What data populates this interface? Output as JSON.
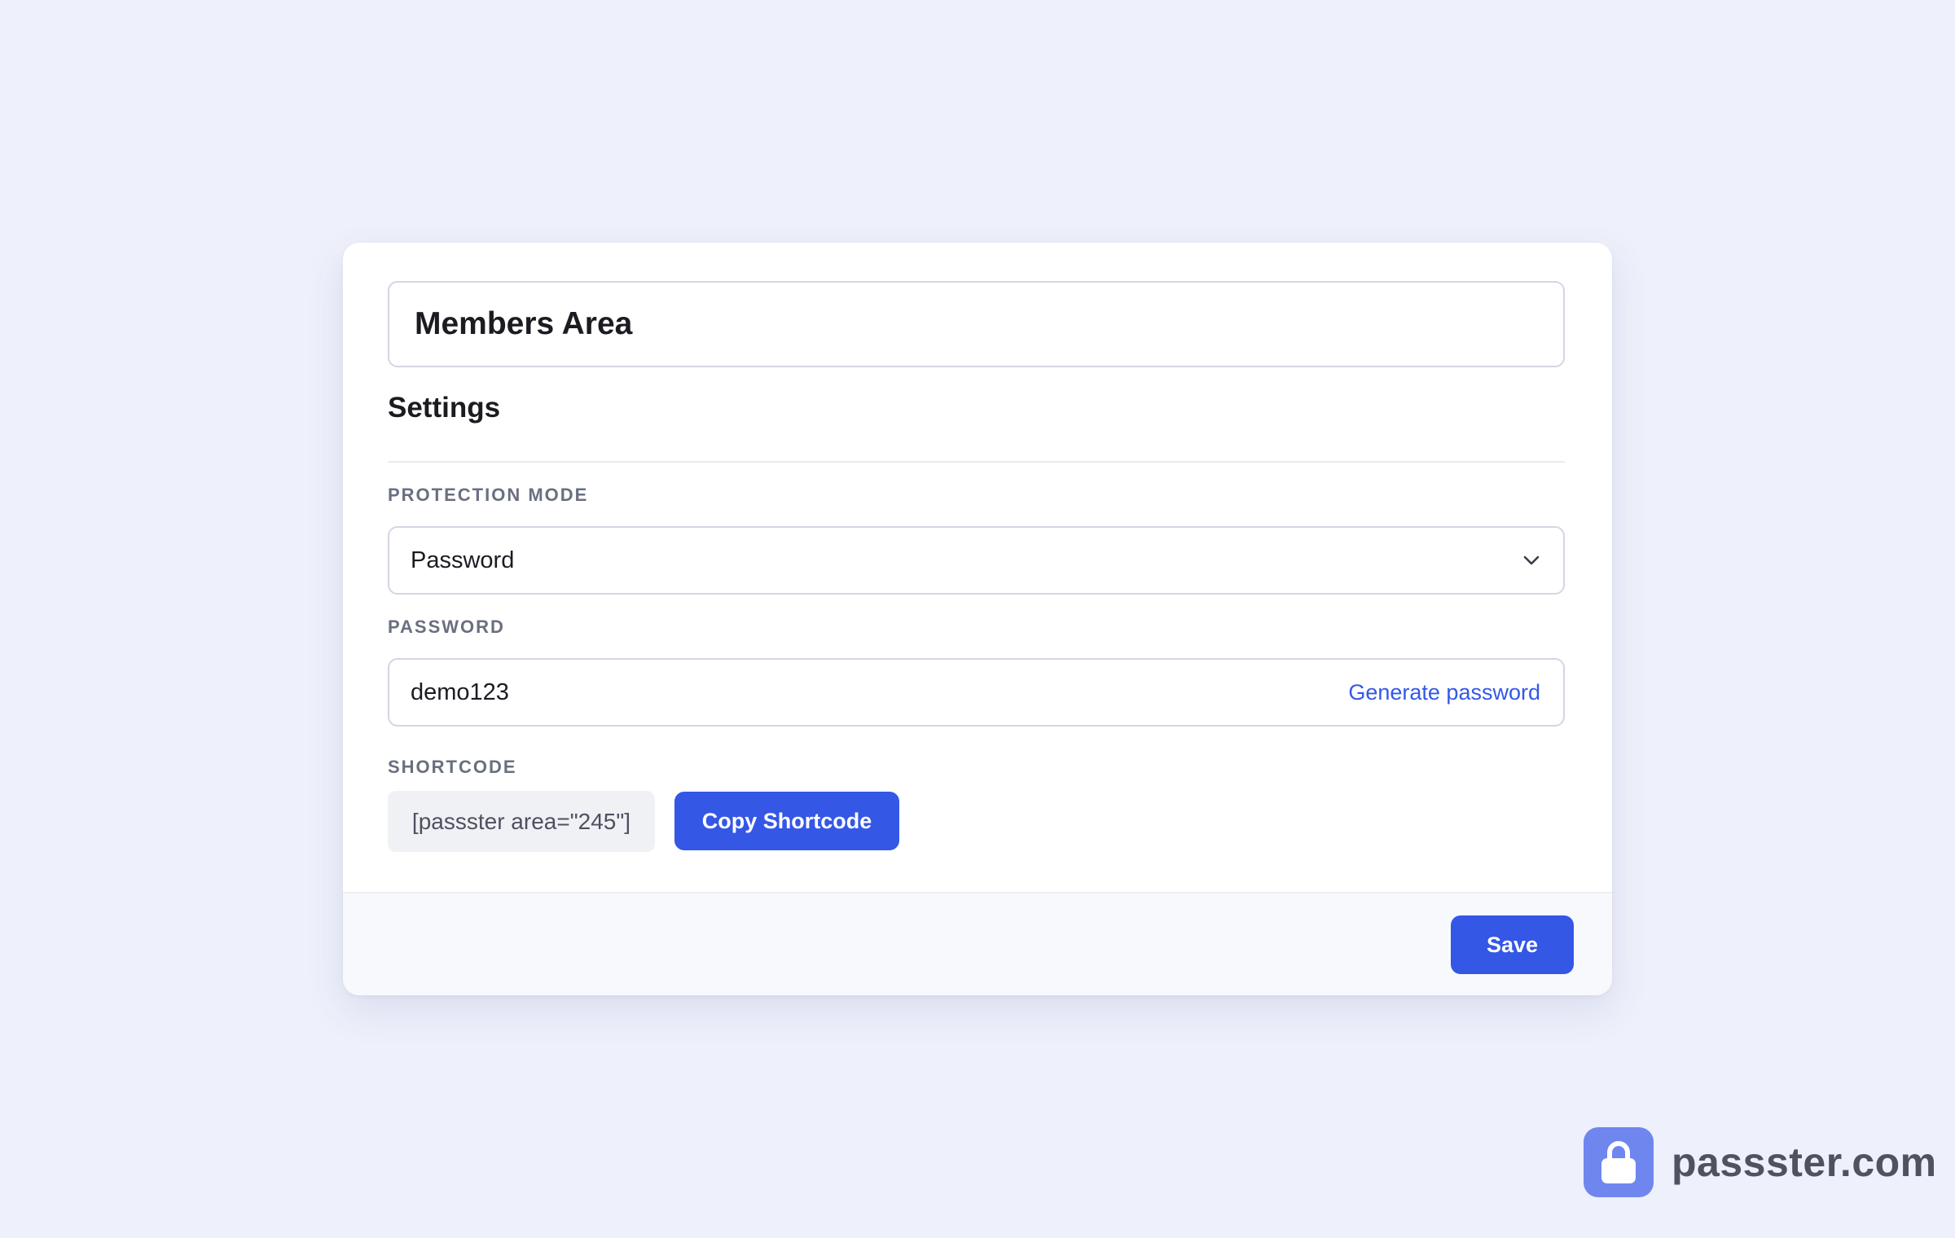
{
  "form": {
    "title_value": "Members Area",
    "settings_heading": "Settings",
    "protection_mode": {
      "label": "PROTECTION MODE",
      "selected": "Password"
    },
    "password": {
      "label": "PASSWORD",
      "value": "demo123",
      "generate_label": "Generate password"
    },
    "shortcode": {
      "label": "SHORTCODE",
      "value": "[passster area=\"245\"]",
      "copy_label": "Copy Shortcode"
    },
    "save_label": "Save"
  },
  "brand": {
    "name": "passster.com",
    "icon": "lock-icon"
  },
  "colors": {
    "background": "#eef0fb",
    "accent": "#3457e6",
    "link": "#3458e6",
    "brand_logo": "#6f86ef"
  }
}
